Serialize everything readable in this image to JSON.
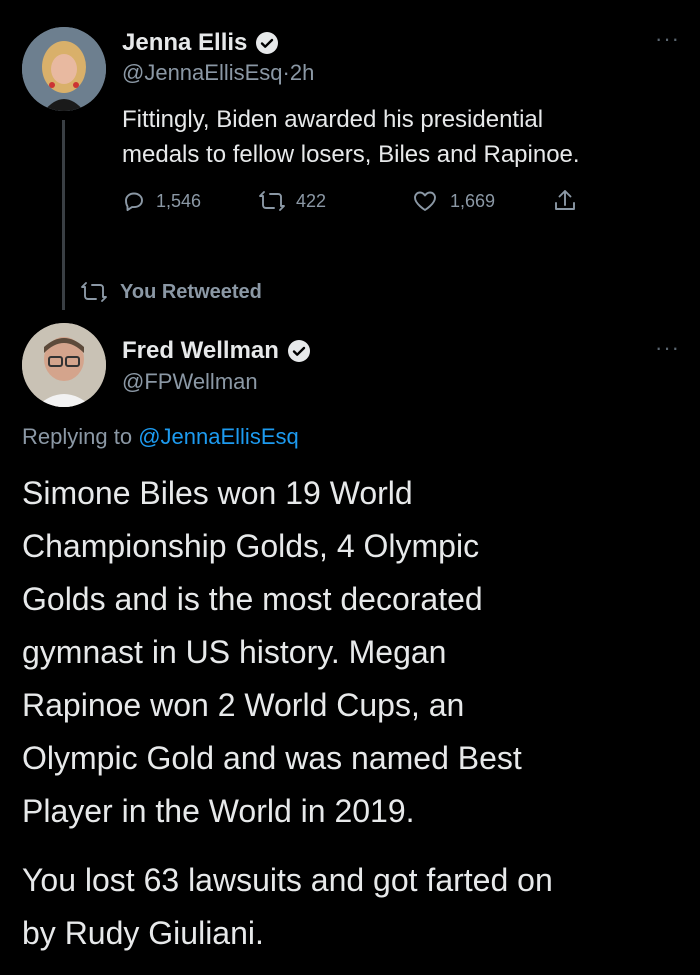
{
  "original_tweet": {
    "author": {
      "name": "Jenna Ellis",
      "handle": "@JennaEllisEsq",
      "time": "2h"
    },
    "separator": "·",
    "text_line1": "Fittingly, Biden awarded his presidential",
    "text_line2": "medals to fellow losers, Biles and Rapinoe.",
    "replies": "1,546",
    "retweets": "422",
    "likes": "1,669",
    "more": "···"
  },
  "retweet_status": {
    "label": "You Retweeted"
  },
  "reply_tweet": {
    "author": {
      "name": "Fred Wellman",
      "handle": "@FPWellman"
    },
    "replying_prefix": "Replying to",
    "replying_to": "@JennaEllisEsq",
    "more": "···",
    "paragraph1": [
      "Simone Biles won 19 World",
      "Championship Golds, 4 Olympic",
      "Golds and is the most decorated",
      "gymnast in US history. Megan",
      "Rapinoe won 2 World Cups, an",
      "Olympic Gold and was named Best",
      "Player in the World in 2019."
    ],
    "paragraph2": [
      "You lost 63 lawsuits and got farted on",
      "by Rudy Giuliani."
    ]
  },
  "colors": {
    "background": "#000000",
    "text": "#e7e9ea",
    "muted": "#8b98a5",
    "link": "#1d9bf0"
  }
}
